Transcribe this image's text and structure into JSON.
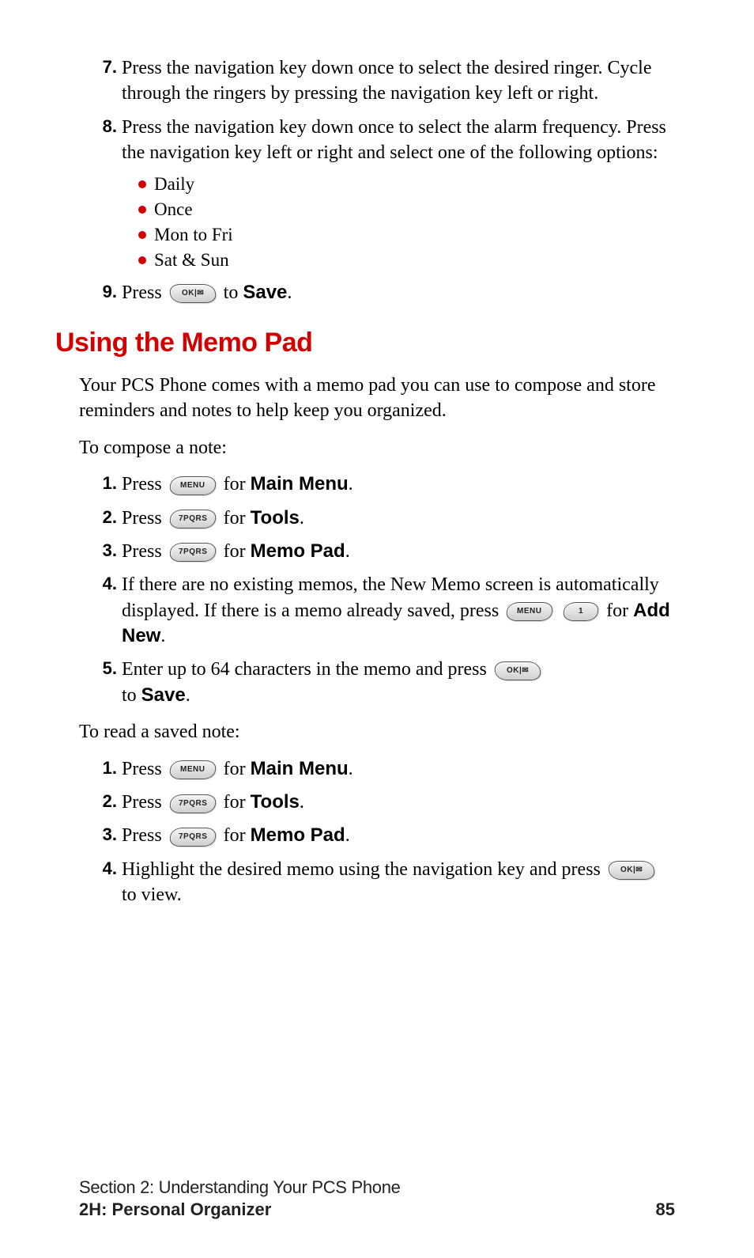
{
  "steps_top": [
    {
      "num": "7.",
      "text": "Press the navigation key down once to select the desired ringer. Cycle through the ringers by pressing the navigation key left or right."
    },
    {
      "num": "8.",
      "text": "Press the navigation key down once to select the alarm frequency. Press the navigation key left or right and select one of the following options:"
    }
  ],
  "freq_options": [
    "Daily",
    "Once",
    "Mon to Fri",
    "Sat & Sun"
  ],
  "step9": {
    "num": "9.",
    "press": "Press",
    "to": " to ",
    "save": "Save",
    "dot": "."
  },
  "section_title": "Using the Memo Pad",
  "intro": "Your PCS Phone comes with a memo pad you can use to compose and store reminders and notes to help keep you organized.",
  "compose_lead": "To compose a note:",
  "compose": {
    "s1": {
      "num": "1.",
      "press": "Press",
      "for": " for ",
      "target": "Main Menu",
      "dot": "."
    },
    "s2": {
      "num": "2.",
      "press": "Press",
      "for": " for ",
      "target": "Tools",
      "dot": "."
    },
    "s3": {
      "num": "3.",
      "press": "Press",
      "for": " for ",
      "target": "Memo Pad",
      "dot": "."
    },
    "s4": {
      "num": "4.",
      "part1": "If there are no existing memos, the New Memo screen is automatically displayed. If there is a memo already saved, press",
      "for": " for ",
      "target": "Add New",
      "dot": "."
    },
    "s5": {
      "num": "5.",
      "part1": "Enter up to 64 characters in the memo and press",
      "to": "to ",
      "target": "Save",
      "dot": "."
    }
  },
  "read_lead": "To read a saved note:",
  "read": {
    "s1": {
      "num": "1.",
      "press": "Press",
      "for": " for ",
      "target": "Main Menu",
      "dot": "."
    },
    "s2": {
      "num": "2.",
      "press": "Press",
      "for": " for ",
      "target": "Tools",
      "dot": "."
    },
    "s3": {
      "num": "3.",
      "press": "Press",
      "for": " for ",
      "target": "Memo Pad",
      "dot": "."
    },
    "s4": {
      "num": "4.",
      "part1": "Highlight the desired memo using the navigation key and press",
      "tail": " to view."
    }
  },
  "keys": {
    "ok": "OK|✉",
    "menu": "MENU",
    "seven": "7PQRS",
    "one": "1"
  },
  "footer": {
    "line1": "Section 2: Understanding Your PCS Phone",
    "line2_left": "2H: Personal Organizer",
    "line2_right": "85"
  }
}
